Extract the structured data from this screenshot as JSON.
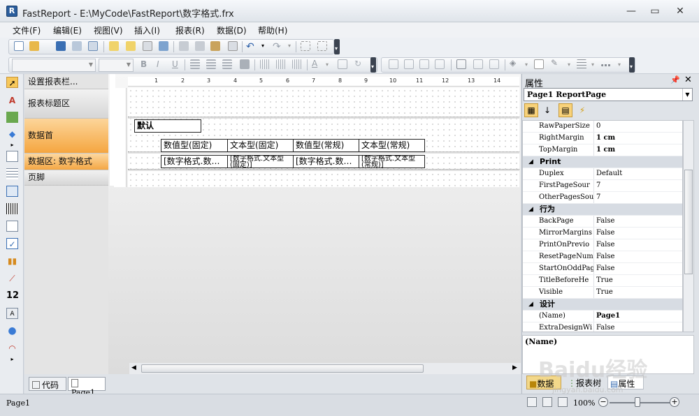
{
  "window": {
    "title": "FastReport - E:\\MyCode\\FastReport\\数字格式.frx",
    "icon_label": "R",
    "minimize": "—",
    "maximize": "▭",
    "close": "✕"
  },
  "menu": [
    "文件(F)",
    "编辑(E)",
    "视图(V)",
    "插入(I)",
    "报表(R)",
    "数据(D)",
    "帮助(H)"
  ],
  "bands": {
    "header_label": "设置报表栏...",
    "title_band": "报表标题区",
    "page_header": "数据首",
    "data_band": "数据区: 数字格式",
    "page_footer": "页脚"
  },
  "ruler": [
    "1",
    "2",
    "3",
    "4",
    "5",
    "6",
    "7",
    "8",
    "9",
    "10",
    "11",
    "12",
    "13",
    "14"
  ],
  "design": {
    "default_label": "默认",
    "headers": [
      "数值型(固定)",
      "文本型(固定)",
      "数值型(常规)",
      "文本型(常规)"
    ],
    "cells": [
      "[数字格式.数…",
      "[数字格式.文本型(固定)]",
      "[数字格式.数…",
      "[数字格式.文本型(常规)]"
    ]
  },
  "bottom_tabs": {
    "code": "代码",
    "page": "Page1"
  },
  "properties": {
    "panel_title": "属性",
    "object": "Page1 ReportPage",
    "rows": [
      {
        "type": "prop",
        "name": "RawPaperSize",
        "value": "0"
      },
      {
        "type": "prop",
        "name": "RightMargin",
        "value": "1 cm"
      },
      {
        "type": "prop",
        "name": "TopMargin",
        "value": "1 cm"
      },
      {
        "type": "cat",
        "name": "Print"
      },
      {
        "type": "prop",
        "name": "Duplex",
        "value": "Default"
      },
      {
        "type": "prop",
        "name": "FirstPageSour",
        "value": "7"
      },
      {
        "type": "prop",
        "name": "OtherPagesSou",
        "value": "7"
      },
      {
        "type": "cat",
        "name": "行为"
      },
      {
        "type": "prop",
        "name": "BackPage",
        "value": "False"
      },
      {
        "type": "prop",
        "name": "MirrorMargins",
        "value": "False"
      },
      {
        "type": "prop",
        "name": "PrintOnPrevio",
        "value": "False"
      },
      {
        "type": "prop",
        "name": "ResetPageNumb",
        "value": "False"
      },
      {
        "type": "prop",
        "name": "StartOnOddPag",
        "value": "False"
      },
      {
        "type": "prop",
        "name": "TitleBeforeHe",
        "value": "True"
      },
      {
        "type": "prop",
        "name": "Visible",
        "value": "True"
      },
      {
        "type": "cat",
        "name": "设计"
      },
      {
        "type": "prop",
        "name": "(Name)",
        "value": "Page1"
      },
      {
        "type": "prop",
        "name": "ExtraDesignWi",
        "value": "False"
      }
    ],
    "description": "(Name)",
    "tabs": [
      "数据",
      "报表树",
      "属性"
    ]
  },
  "status": {
    "text": "Page1",
    "zoom": "100%"
  },
  "watermark": {
    "logo": "Baidu经验",
    "url": "jingyan.baidu.com"
  }
}
